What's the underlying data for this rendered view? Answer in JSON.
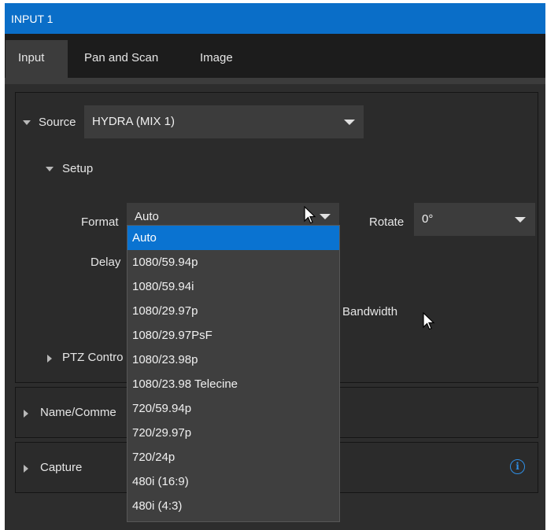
{
  "window": {
    "title": "INPUT 1"
  },
  "tabs": [
    {
      "label": "Input",
      "active": true
    },
    {
      "label": "Pan and Scan",
      "active": false
    },
    {
      "label": "Image",
      "active": false
    }
  ],
  "source": {
    "label": "Source",
    "value": "HYDRA (MIX 1)"
  },
  "setup": {
    "label": "Setup",
    "format": {
      "label": "Format",
      "value": "Auto"
    },
    "rotate": {
      "label": "Rotate",
      "value": "0°"
    },
    "delay": {
      "label": "Delay"
    },
    "bandwidth_partial": "w Bandwidth",
    "ptz_partial": "PTZ Contro"
  },
  "format_options": [
    "Auto",
    "1080/59.94p",
    "1080/59.94i",
    "1080/29.97p",
    "1080/29.97PsF",
    "1080/23.98p",
    "1080/23.98 Telecine",
    "720/59.94p",
    "720/29.97p",
    "720/24p",
    "480i (16:9)",
    "480i (4:3)"
  ],
  "format_selected_index": 0,
  "sections": {
    "name_comments_partial": "Name/Comme",
    "capture": "Capture"
  },
  "colors": {
    "title_bar": "#0a6ec8",
    "selection": "#0a73d1",
    "info_icon": "#2f8fe6"
  },
  "icons": [
    "chevron-down-icon",
    "expand-triangle-icon",
    "info-icon",
    "mouse-pointer-icon"
  ]
}
